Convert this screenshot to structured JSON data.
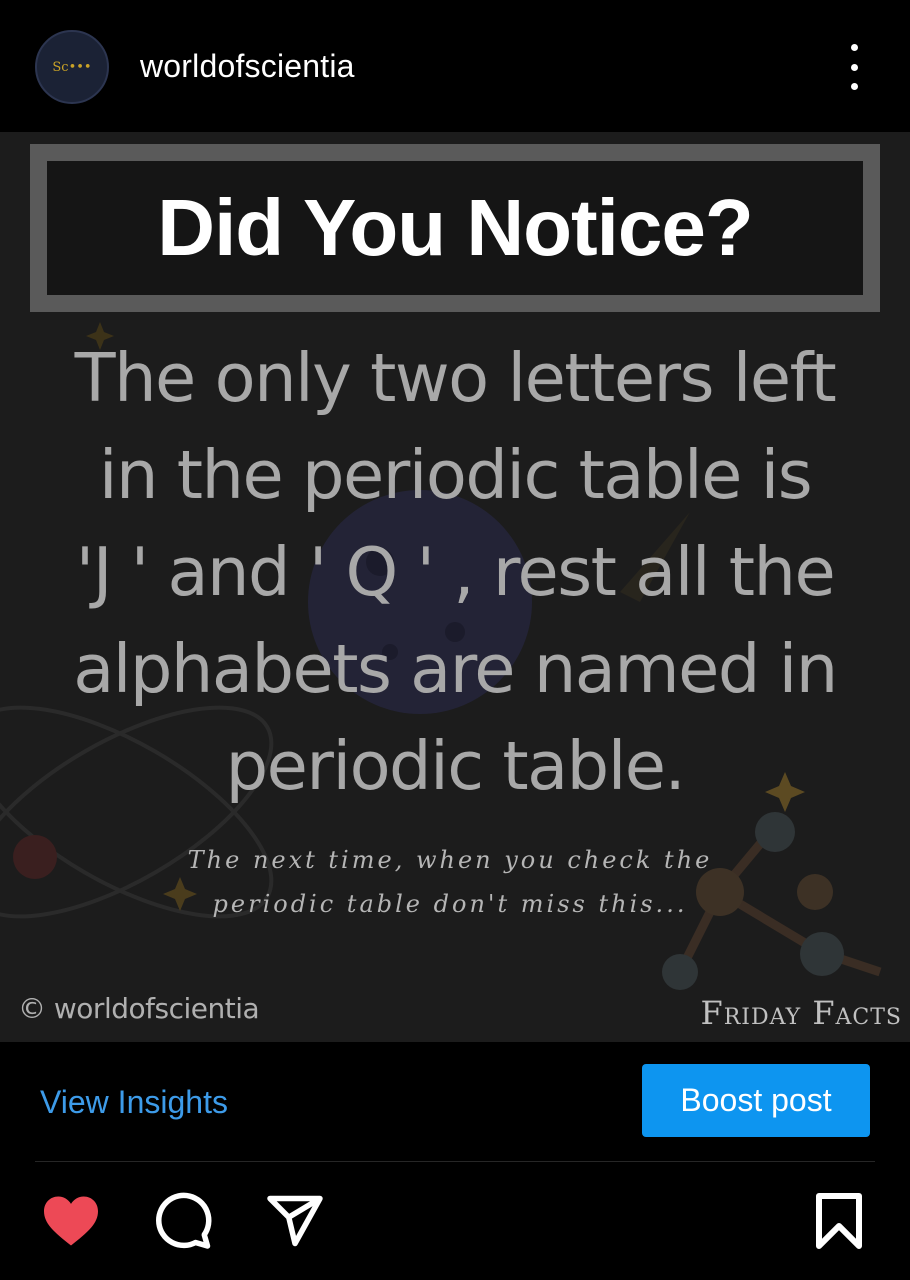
{
  "header": {
    "username": "worldofscientia",
    "avatar_text": "Sc•••"
  },
  "post": {
    "title": "Did You Notice?",
    "fact_lines": [
      "The only two letters left",
      "in the periodic table is",
      "'J ' and ' Q ' , rest all the",
      "alphabets are named in",
      "periodic table."
    ],
    "subtext_lines": [
      "The next time, when you check the",
      "periodic table don't miss this..."
    ],
    "copyright": "© worldofscientia",
    "series": "Friday Facts"
  },
  "insights": {
    "view_label": "View Insights",
    "boost_label": "Boost post"
  },
  "actions": {
    "like_icon": "heart-icon",
    "comment_icon": "comment-icon",
    "share_icon": "share-icon",
    "save_icon": "bookmark-icon"
  },
  "colors": {
    "link_blue": "#3d9be9",
    "boost_blue": "#0d95f0",
    "like_red": "#ed4956",
    "title_border": "#5a5a5a"
  }
}
